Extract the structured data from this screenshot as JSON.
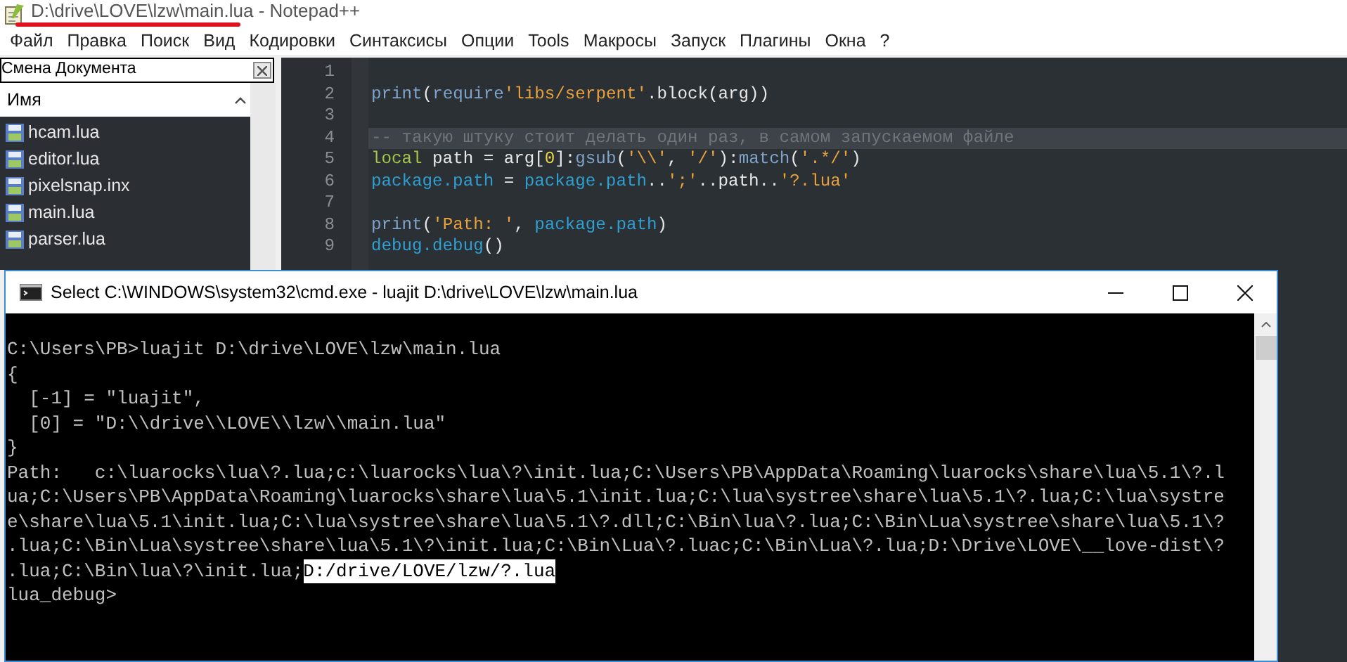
{
  "notepad": {
    "title": "D:\\drive\\LOVE\\lzw\\main.lua - Notepad++",
    "menu": [
      "Файл",
      "Правка",
      "Поиск",
      "Вид",
      "Кодировки",
      "Синтаксисы",
      "Опции",
      "Tools",
      "Макросы",
      "Запуск",
      "Плагины",
      "Окна",
      "?"
    ],
    "doc_panel": {
      "title": "Смена Документа",
      "column": "Имя",
      "files": [
        "hcam.lua",
        "editor.lua",
        "pixelsnap.inx",
        "main.lua",
        "parser.lua"
      ]
    },
    "editor": {
      "lines": [
        {
          "number": "1",
          "current": false
        },
        {
          "number": "2",
          "current": false,
          "tokens": [
            {
              "kind": "function",
              "text": "print"
            },
            {
              "kind": "text",
              "text": "("
            },
            {
              "kind": "function",
              "text": "require"
            },
            {
              "kind": "string",
              "text": "'libs/serpent'"
            },
            {
              "kind": "text",
              "text": ".block(arg))"
            }
          ]
        },
        {
          "number": "3",
          "current": false
        },
        {
          "number": "4",
          "current": true,
          "tokens": [
            {
              "kind": "comment",
              "text": "-- такую штуку стоит делать один раз, в самом запускаемом файле"
            }
          ]
        },
        {
          "number": "5",
          "current": false,
          "tokens": [
            {
              "kind": "keyword",
              "text": "local"
            },
            {
              "kind": "text",
              "text": " path = arg["
            },
            {
              "kind": "number",
              "text": "0"
            },
            {
              "kind": "text",
              "text": "]:"
            },
            {
              "kind": "function",
              "text": "gsub"
            },
            {
              "kind": "text",
              "text": "("
            },
            {
              "kind": "string",
              "text": "'\\\\'"
            },
            {
              "kind": "text",
              "text": ", "
            },
            {
              "kind": "string",
              "text": "'/'"
            },
            {
              "kind": "text",
              "text": "):"
            },
            {
              "kind": "function",
              "text": "match"
            },
            {
              "kind": "text",
              "text": "("
            },
            {
              "kind": "string",
              "text": "'.*/'"
            },
            {
              "kind": "text",
              "text": ")"
            }
          ]
        },
        {
          "number": "6",
          "current": false,
          "tokens": [
            {
              "kind": "field",
              "text": "package.path"
            },
            {
              "kind": "text",
              "text": " = "
            },
            {
              "kind": "field",
              "text": "package.path"
            },
            {
              "kind": "text",
              "text": ".."
            },
            {
              "kind": "string",
              "text": "';'"
            },
            {
              "kind": "text",
              "text": "..path.."
            },
            {
              "kind": "string",
              "text": "'?.lua'"
            }
          ]
        },
        {
          "number": "7",
          "current": false
        },
        {
          "number": "8",
          "current": false,
          "tokens": [
            {
              "kind": "function",
              "text": "print"
            },
            {
              "kind": "text",
              "text": "("
            },
            {
              "kind": "string",
              "text": "'Path: '"
            },
            {
              "kind": "text",
              "text": ", "
            },
            {
              "kind": "field",
              "text": "package.path"
            },
            {
              "kind": "text",
              "text": ")"
            }
          ]
        },
        {
          "number": "9",
          "current": false,
          "tokens": [
            {
              "kind": "field",
              "text": "debug.debug"
            },
            {
              "kind": "text",
              "text": "()"
            }
          ]
        }
      ]
    }
  },
  "console": {
    "title": "Select C:\\WINDOWS\\system32\\cmd.exe - luajit  D:\\drive\\LOVE\\lzw\\main.lua",
    "lines": [
      {
        "text": "C:\\Users\\PB>luajit D:\\drive\\LOVE\\lzw\\main.lua"
      },
      {
        "text": "{"
      },
      {
        "text": "  [-1] = \"luajit\","
      },
      {
        "text": "  [0] = \"D:\\\\drive\\\\LOVE\\\\lzw\\\\main.lua\""
      },
      {
        "text": "}"
      },
      {
        "text": "Path:   c:\\luarocks\\lua\\?.lua;c:\\luarocks\\lua\\?\\init.lua;C:\\Users\\PB\\AppData\\Roaming\\luarocks\\share\\lua\\5.1\\?.l"
      },
      {
        "text": "ua;C:\\Users\\PB\\AppData\\Roaming\\luarocks\\share\\lua\\5.1\\init.lua;C:\\lua\\systree\\share\\lua\\5.1\\?.lua;C:\\lua\\systre"
      },
      {
        "text": "e\\share\\lua\\5.1\\init.lua;C:\\lua\\systree\\share\\lua\\5.1\\?.dll;C:\\Bin\\lua\\?.lua;C:\\Bin\\Lua\\systree\\share\\lua\\5.1\\?"
      },
      {
        "text": ".lua;C:\\Bin\\Lua\\systree\\share\\lua\\5.1\\?\\init.lua;C:\\Bin\\Lua\\?.luac;C:\\Bin\\Lua\\?.lua;D:\\Drive\\LOVE\\__love-dist\\?"
      },
      {
        "text": ".lua;C:\\Bin\\lua\\?\\init.lua;",
        "selection": "D:/drive/LOVE/lzw/?.lua"
      },
      {
        "text": "lua_debug>"
      }
    ]
  }
}
